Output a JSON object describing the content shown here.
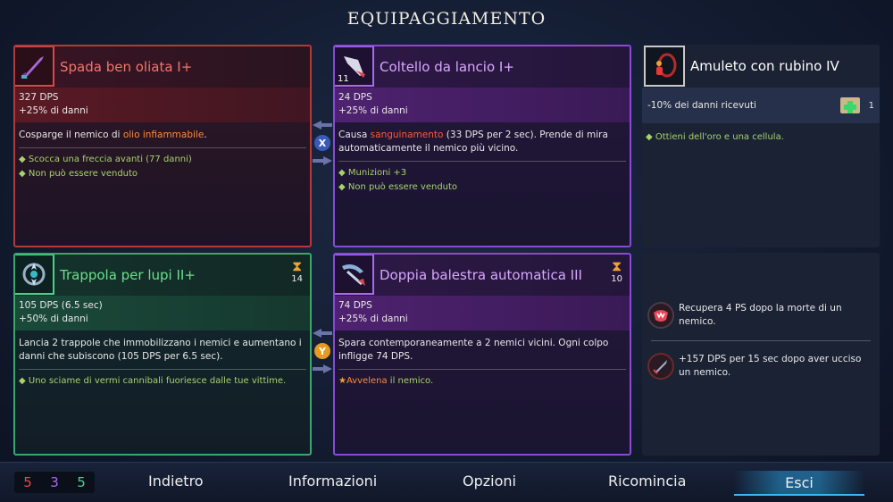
{
  "title": "EQUIPAGGIAMENTO",
  "weapons": [
    {
      "name": "Spada ben oliata I+",
      "dps": "327 DPS",
      "bonus": "+25% di danni",
      "desc_pre": "Cosparge il nemico di ",
      "desc_hl": "olio infiammabile",
      "desc_post": ".",
      "bullets": [
        "Scocca una freccia avanti (77 danni)",
        "Non può essere venduto"
      ]
    },
    {
      "name": "Coltello da lancio I+",
      "ammo": "11",
      "dps": "24 DPS",
      "bonus": "+25% di danni",
      "desc_pre": "Causa ",
      "desc_hl": "sanguinamento",
      "desc_post": " (33 DPS per 2 sec). Prende di mira automaticamente il nemico più vicino.",
      "bullets": [
        "Munizioni +3",
        "Non può essere venduto"
      ]
    }
  ],
  "skills": [
    {
      "name": "Trappola per lupi II+",
      "cooldown": "14",
      "dps": "105 DPS (6.5 sec)",
      "bonus": "+50% di danni",
      "desc": "Lancia 2 trappole che immobilizzano i nemici e aumentano i danni che subiscono (105 DPS per 6.5 sec).",
      "bullets": [
        "Uno sciame di vermi cannibali fuoriesce dalle tue vittime."
      ]
    },
    {
      "name": "Doppia balestra automatica III",
      "cooldown": "10",
      "dps": "74 DPS",
      "bonus": "+25% di danni",
      "desc": "Spara contemporaneamente a 2 nemici vicini. Ogni colpo infligge 74 DPS.",
      "bullet_hl": "Avvelena",
      "bullet_post": " il nemico."
    }
  ],
  "amulet": {
    "name": "Amuleto con rubino IV",
    "stat": "-10% dei danni ricevuti",
    "scroll_count": "1",
    "bullet": "Ottieni dell'oro e una cellula."
  },
  "mutations": [
    {
      "text": "Recupera 4 PS dopo la morte di un nemico."
    },
    {
      "text": "+157 DPS per 15 sec dopo aver ucciso un nemico."
    }
  ],
  "swap_buttons": [
    "X",
    "Y"
  ],
  "counters": {
    "red": "5",
    "purple": "3",
    "green": "5"
  },
  "nav": {
    "back": "Indietro",
    "info": "Informazioni",
    "options": "Opzioni",
    "restart": "Ricomincia",
    "exit": "Esci"
  },
  "colors": {
    "brutality": "#e04848",
    "tactics": "#a86af0",
    "survival": "#4ad08a",
    "cooldown": "#f0a230",
    "accent": "#3ab8f0"
  }
}
